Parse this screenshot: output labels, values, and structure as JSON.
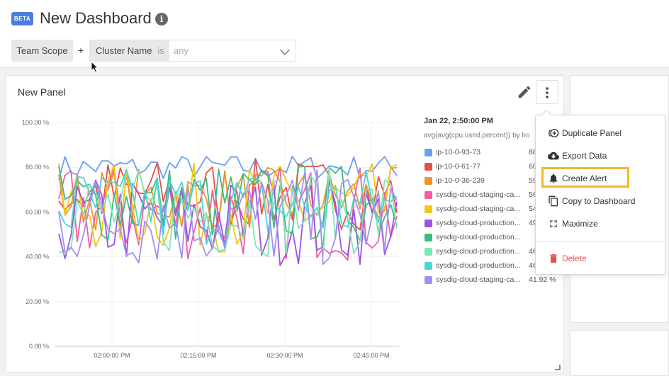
{
  "header": {
    "badge": "BETA",
    "title": "New Dashboard",
    "info_icon": "info-icon"
  },
  "scope": {
    "team_scope": "Team Scope",
    "plus": "+",
    "filter_key": "Cluster Name",
    "filter_op": "is",
    "filter_value_placeholder": "any"
  },
  "panel": {
    "title": "New Panel",
    "edit_icon": "pencil-icon",
    "more_icon": "more-vertical-icon"
  },
  "legend": {
    "timestamp": "Jan 22, 2:50:00 PM",
    "metric": "avg(avg(cpu.used.percent)) by ho",
    "items": [
      {
        "name": "ip-10-0-93-73",
        "value": "88",
        "color": "#6b9ef2"
      },
      {
        "name": "ip-10-0-61-77",
        "value": "60",
        "color": "#e8504a"
      },
      {
        "name": "ip-10-0-36-239",
        "value": "59",
        "color": "#f0932f"
      },
      {
        "name": "sysdig-cloud-staging-ca...",
        "value": "56",
        "color": "#ef5fa4"
      },
      {
        "name": "sysdig-cloud-staging-ca...",
        "value": "54",
        "color": "#f2c810"
      },
      {
        "name": "sysdig-cloud-production...",
        "value": "49",
        "color": "#9b54e0"
      },
      {
        "name": "sysdig-cloud-production...",
        "value": "",
        "color": "#3dbb85"
      },
      {
        "name": "sysdig-cloud-production...",
        "value": "46",
        "color": "#7fe6b8"
      },
      {
        "name": "sysdig-cloud-production...",
        "value": "46",
        "color": "#4bd6d6"
      },
      {
        "name": "sysdig-cloud-staging-ca...",
        "value": "41.92 %",
        "color": "#a58ff2"
      }
    ]
  },
  "menu": {
    "items": [
      {
        "label": "Duplicate Panel",
        "icon": "duplicate-icon"
      },
      {
        "label": "Export Data",
        "icon": "cloud-download-icon"
      },
      {
        "label": "Create Alert",
        "icon": "bell-icon"
      },
      {
        "label": "Copy to Dashboard",
        "icon": "copy-icon"
      },
      {
        "label": "Maximize",
        "icon": "maximize-icon"
      },
      {
        "label": "Delete",
        "icon": "trash-icon",
        "color": "#e0504a"
      }
    ]
  },
  "chart_data": {
    "type": "line",
    "y_ticks": [
      "0.00 %",
      "20.00 %",
      "40.00 %",
      "60.00 %",
      "80.00 %",
      "100.00 %"
    ],
    "x_ticks": [
      "02:00:00 PM",
      "02:15:00 PM",
      "02:30:00 PM",
      "02:45:00 PM"
    ],
    "ylim": [
      0,
      100
    ],
    "grid": true
  }
}
